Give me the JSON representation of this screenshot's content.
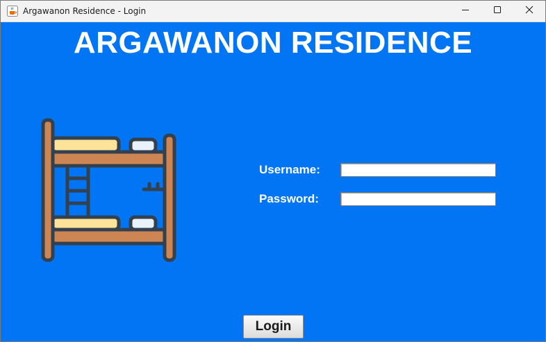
{
  "window": {
    "title": "Argawanon Residence - Login"
  },
  "header": {
    "title": "ARGAWANON RESIDENCE"
  },
  "form": {
    "username_label": "Username:",
    "password_label": "Password:",
    "username_value": "",
    "password_value": "",
    "login_label": "Login"
  },
  "colors": {
    "background": "#0175f3",
    "text": "#ffffff"
  },
  "icons": {
    "app": "java-cup-icon",
    "illustration": "bunk-bed-icon",
    "minimize": "minimize-icon",
    "maximize": "maximize-icon",
    "close": "close-icon"
  }
}
